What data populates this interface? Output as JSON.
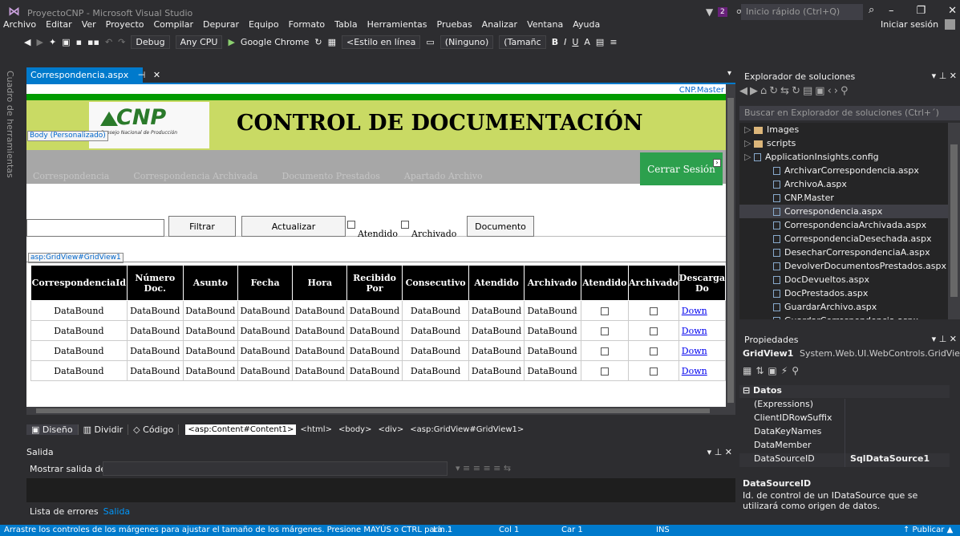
{
  "window": {
    "title": "ProyectoCNP - Microsoft Visual Studio",
    "notification_count": "2",
    "quick_launch_placeholder": "Inicio rápido (Ctrl+Q)",
    "signin": "Iniciar sesión"
  },
  "menu": [
    "Archivo",
    "Editar",
    "Ver",
    "Proyecto",
    "Compilar",
    "Depurar",
    "Equipo",
    "Formato",
    "Tabla",
    "Herramientas",
    "Pruebas",
    "Analizar",
    "Ventana",
    "Ayuda"
  ],
  "toolbar": {
    "config": "Debug",
    "platform": "Any CPU",
    "browser": "Google Chrome",
    "style": "<Estilo en línea",
    "font": "(Ninguno)",
    "size": "(Tamañc",
    "bold": "B",
    "italic": "I",
    "underline": "U"
  },
  "sidebar_label": "Cuadro de herramientas",
  "doc_tab": {
    "label": "Correspondencia.aspx",
    "pin": "⊣",
    "close": "✕"
  },
  "designer": {
    "master_label": "CNP.Master",
    "logo_text": "CNP",
    "logo_sub": "Consejo Nacional de Producción",
    "title": "CONTROL DE DOCUMENTACIÓN",
    "body_label": "Body (Personalizado)",
    "nav": [
      "Correspondencia",
      "Correspondencia Archivada",
      "Documento Prestados",
      "Apartado Archivo"
    ],
    "logout": "Cerrar Sesión",
    "buttons": {
      "filter": "Filtrar",
      "refresh": "Actualizar",
      "document": "Documento"
    },
    "checks": {
      "attended": "Atendido",
      "archived": "Archivado"
    },
    "grid_label": "asp:GridView#GridView1",
    "grid": {
      "headers": [
        "CorrespondenciaId",
        "Número Doc.",
        "Asunto",
        "Fecha",
        "Hora",
        "Recibido Por",
        "Consecutivo",
        "Atendido",
        "Archivado",
        "Atendido",
        "Archivado",
        "Descarga Do"
      ],
      "cell": "DataBound",
      "link": "Down",
      "rows": 4
    }
  },
  "view_bar": {
    "design": "Diseño",
    "split": "Dividir",
    "code": "Código",
    "crumbs": [
      "<asp:Content#Content1>",
      "<html>",
      "<body>",
      "<div>",
      "<asp:GridView#GridView1>"
    ]
  },
  "output": {
    "title": "Salida",
    "show_label": "Mostrar salida de:",
    "tabs": [
      "Lista de errores",
      "Salida"
    ]
  },
  "status": {
    "message": "Arrastre los controles de los márgenes para ajustar el tamaño de los márgenes. Presione MAYÚS o CTRL para...",
    "line": "Lín 1",
    "col": "Col 1",
    "car": "Car 1",
    "ins": "INS",
    "publish": "↑ Publicar ▲"
  },
  "solution_explorer": {
    "title": "Explorador de soluciones",
    "search_placeholder": "Buscar en Explorador de soluciones (Ctrl+´)",
    "items": [
      {
        "label": "Images",
        "kind": "folder",
        "expand": "▷"
      },
      {
        "label": "scripts",
        "kind": "folder",
        "expand": "▷"
      },
      {
        "label": "ApplicationInsights.config",
        "kind": "file",
        "expand": "▷"
      },
      {
        "label": "ArchivarCorrespondencia.aspx",
        "kind": "page"
      },
      {
        "label": "ArchivoA.aspx",
        "kind": "page"
      },
      {
        "label": "CNP.Master",
        "kind": "page"
      },
      {
        "label": "Correspondencia.aspx",
        "kind": "page",
        "selected": true
      },
      {
        "label": "CorrespondenciaArchivada.aspx",
        "kind": "page"
      },
      {
        "label": "CorrespondenciaDesechada.aspx",
        "kind": "page"
      },
      {
        "label": "DesecharCorrespondenciaA.aspx",
        "kind": "page"
      },
      {
        "label": "DevolverDocumentosPrestados.aspx",
        "kind": "page"
      },
      {
        "label": "DocDevueltos.aspx",
        "kind": "page"
      },
      {
        "label": "DocPrestados.aspx",
        "kind": "page"
      },
      {
        "label": "GuardarArchivo.aspx",
        "kind": "page"
      },
      {
        "label": "GuardarCorrespondencia.aspx",
        "kind": "page"
      }
    ]
  },
  "properties": {
    "title": "Propiedades",
    "object": "GridView1",
    "object_type": "System.Web.UI.WebControls.GridView",
    "category": "Datos",
    "rows": [
      {
        "name": "(Expressions)",
        "value": ""
      },
      {
        "name": "ClientIDRowSuffix",
        "value": ""
      },
      {
        "name": "DataKeyNames",
        "value": ""
      },
      {
        "name": "DataMember",
        "value": ""
      },
      {
        "name": "DataSourceID",
        "value": "SqlDataSource1"
      }
    ],
    "desc_title": "DataSourceID",
    "desc_text": "Id. de control de un IDataSource que se utilizará como origen de datos."
  }
}
